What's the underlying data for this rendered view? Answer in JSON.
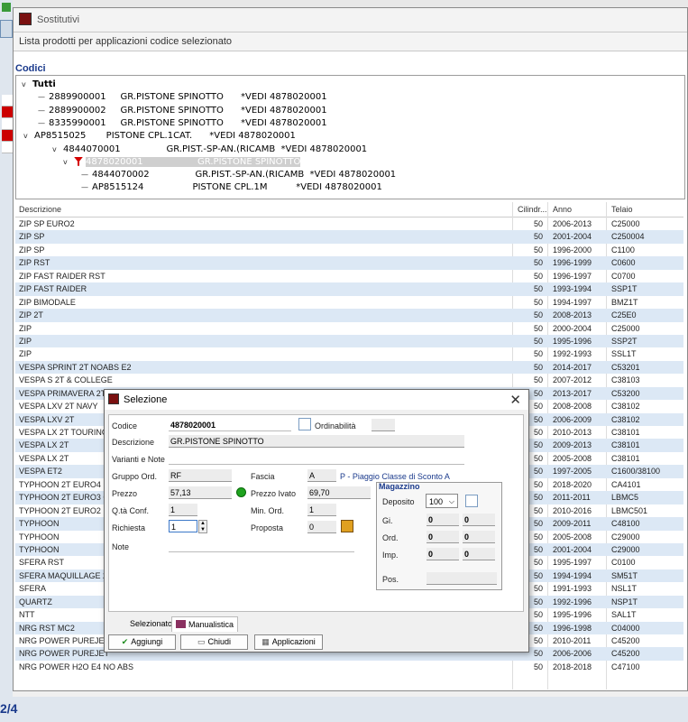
{
  "window": {
    "title": "Sostitutivi",
    "subheader": "Lista prodotti per applicazioni codice selezionato",
    "codici_label": "Codici"
  },
  "background": {
    "codici_label": "Codici",
    "status_text": "2/4"
  },
  "tree": [
    {
      "text": "Tutti",
      "bold": true,
      "expander": "v"
    },
    {
      "text": "2889900001     GR.PISTONE SPINOTTO      *VEDI 4878020001"
    },
    {
      "text": "2889900002     GR.PISTONE SPINOTTO      *VEDI 4878020001"
    },
    {
      "text": "8335990001     GR.PISTONE SPINOTTO      *VEDI 4878020001"
    },
    {
      "text": "AP8515025       PISTONE CPL.1CAT.      *VEDI 4878020001",
      "expander": "v"
    },
    {
      "text": "4844070001                GR.PIST.-SP-AN.(RICAMB  *VEDI 4878020001",
      "expander": "v"
    },
    {
      "text": "4878020001                   GR.PISTONE SPINOTTO",
      "expander": "v",
      "selected": true,
      "filter": true
    },
    {
      "text": "4844070002                GR.PIST.-SP-AN.(RICAMB  *VEDI 4878020001"
    },
    {
      "text": "AP8515124                 PISTONE CPL.1M          *VEDI 4878020001"
    }
  ],
  "grid": {
    "headers": {
      "descrizione": "Descrizione",
      "cilindrata": "Cilindr...",
      "anno": "Anno",
      "telaio": "Telaio"
    },
    "rows": [
      {
        "desc": "ZIP SP EURO2",
        "cil": "50",
        "anno": "2006-2013",
        "telaio": "C25000"
      },
      {
        "desc": "ZIP SP",
        "cil": "50",
        "anno": "2001-2004",
        "telaio": "C250004"
      },
      {
        "desc": "ZIP SP",
        "cil": "50",
        "anno": "1996-2000",
        "telaio": "C1100"
      },
      {
        "desc": "ZIP RST",
        "cil": "50",
        "anno": "1996-1999",
        "telaio": "C0600"
      },
      {
        "desc": "ZIP FAST RAIDER RST",
        "cil": "50",
        "anno": "1996-1997",
        "telaio": "C0700"
      },
      {
        "desc": "ZIP FAST RAIDER",
        "cil": "50",
        "anno": "1993-1994",
        "telaio": "SSP1T"
      },
      {
        "desc": "ZIP BIMODALE",
        "cil": "50",
        "anno": "1994-1997",
        "telaio": "BMZ1T"
      },
      {
        "desc": "ZIP 2T",
        "cil": "50",
        "anno": "2008-2013",
        "telaio": "C25E0"
      },
      {
        "desc": "ZIP",
        "cil": "50",
        "anno": "2000-2004",
        "telaio": "C25000"
      },
      {
        "desc": "ZIP",
        "cil": "50",
        "anno": "1995-1996",
        "telaio": "SSP2T"
      },
      {
        "desc": "ZIP",
        "cil": "50",
        "anno": "1992-1993",
        "telaio": "SSL1T"
      },
      {
        "desc": "VESPA SPRINT 2T NOABS E2",
        "cil": "50",
        "anno": "2014-2017",
        "telaio": "C53201"
      },
      {
        "desc": "VESPA S 2T & COLLEGE",
        "cil": "50",
        "anno": "2007-2012",
        "telaio": "C38103"
      },
      {
        "desc": "VESPA PRIMAVERA 2T",
        "cil": "50",
        "anno": "2013-2017",
        "telaio": "C53200"
      },
      {
        "desc": "VESPA LXV 2T NAVY",
        "cil": "50",
        "anno": "2008-2008",
        "telaio": "C38102"
      },
      {
        "desc": "VESPA LXV 2T",
        "cil": "50",
        "anno": "2006-2009",
        "telaio": "C38102"
      },
      {
        "desc": "VESPA LX 2T TOURING &",
        "cil": "50",
        "anno": "2010-2013",
        "telaio": "C38101"
      },
      {
        "desc": "VESPA LX 2T",
        "cil": "50",
        "anno": "2009-2013",
        "telaio": "C38101"
      },
      {
        "desc": "VESPA LX 2T",
        "cil": "50",
        "anno": "2005-2008",
        "telaio": "C38101"
      },
      {
        "desc": "VESPA ET2",
        "cil": "50",
        "anno": "1997-2005",
        "telaio": "C1600/38100"
      },
      {
        "desc": "TYPHOON 2T EURO4",
        "cil": "50",
        "anno": "2018-2020",
        "telaio": "CA4101"
      },
      {
        "desc": "TYPHOON 2T EURO3 CH",
        "cil": "50",
        "anno": "2011-2011",
        "telaio": "LBMC5"
      },
      {
        "desc": "TYPHOON 2T EURO2",
        "cil": "50",
        "anno": "2010-2016",
        "telaio": "LBMC501"
      },
      {
        "desc": "TYPHOON",
        "cil": "50",
        "anno": "2009-2011",
        "telaio": "C48100"
      },
      {
        "desc": "TYPHOON",
        "cil": "50",
        "anno": "2005-2008",
        "telaio": "C29000"
      },
      {
        "desc": "TYPHOON",
        "cil": "50",
        "anno": "2001-2004",
        "telaio": "C29000"
      },
      {
        "desc": "SFERA RST",
        "cil": "50",
        "anno": "1995-1997",
        "telaio": "C0100"
      },
      {
        "desc": "SFERA MAQUILLAGE 2",
        "cil": "50",
        "anno": "1994-1994",
        "telaio": "SM51T"
      },
      {
        "desc": "SFERA",
        "cil": "50",
        "anno": "1991-1993",
        "telaio": "NSL1T"
      },
      {
        "desc": "QUARTZ",
        "cil": "50",
        "anno": "1992-1996",
        "telaio": "NSP1T"
      },
      {
        "desc": "NTT",
        "cil": "50",
        "anno": "1995-1996",
        "telaio": "SAL1T"
      },
      {
        "desc": "NRG RST MC2",
        "cil": "50",
        "anno": "1996-1998",
        "telaio": "C04000"
      },
      {
        "desc": "NRG POWER PUREJET",
        "cil": "50",
        "anno": "2010-2011",
        "telaio": "C45200"
      },
      {
        "desc": "NRG POWER PUREJET",
        "cil": "50",
        "anno": "2006-2006",
        "telaio": "C45200"
      },
      {
        "desc": "NRG POWER H2O E4 NO ABS",
        "cil": "50",
        "anno": "2018-2018",
        "telaio": "C47100"
      }
    ]
  },
  "dialog": {
    "title": "Selezione",
    "labels": {
      "codice": "Codice",
      "ordinabilita": "Ordinabilità",
      "descrizione": "Descrizione",
      "varianti": "Varianti e Note",
      "gruppo": "Gruppo Ord.",
      "fascia": "Fascia",
      "prezzo": "Prezzo",
      "prezzo_ivato": "Prezzo Ivato",
      "qta_conf": "Q.tà Conf.",
      "min_ord": "Min. Ord.",
      "richiesta": "Richiesta",
      "proposta": "Proposta",
      "note": "Note"
    },
    "values": {
      "codice": "4878020001",
      "descrizione": "GR.PISTONE SPINOTTO",
      "gruppo": "RF",
      "fascia": "A",
      "fascia_desc": "P - Piaggio Classe di Sconto A",
      "prezzo": "57,13",
      "prezzo_ivato": "69,70",
      "qta_conf": "1",
      "min_ord": "1",
      "richiesta": "1",
      "proposta": "0"
    },
    "magazzino": {
      "title": "Magazzino",
      "deposito_label": "Deposito",
      "deposito_value": "100",
      "rows": [
        {
          "label": "Gi.",
          "a": "0",
          "b": "0"
        },
        {
          "label": "Ord.",
          "a": "0",
          "b": "0"
        },
        {
          "label": "Imp.",
          "a": "0",
          "b": "0"
        }
      ],
      "pos_label": "Pos."
    },
    "tabs": {
      "selezionato": "Selezionato",
      "manualistica": "Manualistica"
    },
    "buttons": {
      "aggiungi": "Aggiungi",
      "chiudi": "Chiudi",
      "applicazioni": "Applicazioni"
    }
  }
}
